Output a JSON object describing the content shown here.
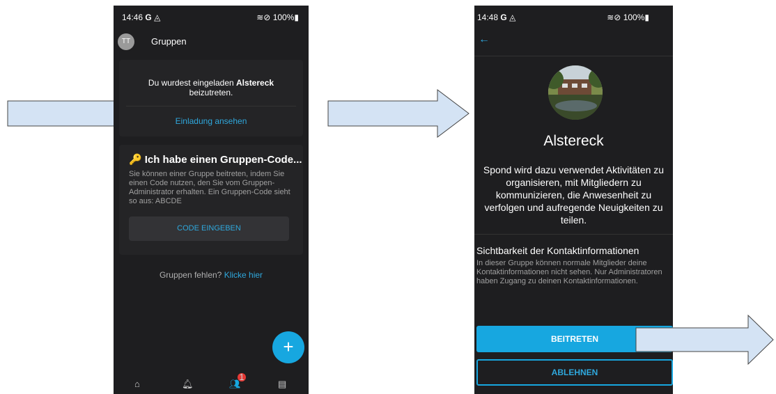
{
  "screen1": {
    "status": {
      "time": "14:46",
      "g": "G",
      "icons_right": "100%"
    },
    "header": {
      "avatar": "TT",
      "title": "Gruppen"
    },
    "invite": {
      "text_prefix": "Du wurdest eingeladen ",
      "group": "Alstereck",
      "text_suffix": " beizutreten.",
      "link": "Einladung ansehen"
    },
    "code": {
      "title": "Ich habe einen Gruppen-Code...",
      "description": "Sie können einer Gruppe beitreten, indem Sie einen Code nutzen, den Sie vom Gruppen-Administrator erhalten. Ein Gruppen-Code sieht so aus: ABCDE",
      "button": "CODE EINGEBEN"
    },
    "missing": {
      "text": "Gruppen fehlen? ",
      "link": "Klicke hier"
    },
    "fab": "+",
    "nav": {
      "badge": "1"
    }
  },
  "screen2": {
    "status": {
      "time": "14:48",
      "g": "G",
      "icons_right": "100%"
    },
    "group_name": "Alstereck",
    "description": "Spond wird dazu verwendet Aktivitäten zu organisieren, mit Mitgliedern zu kommunizieren, die Anwesenheit zu verfolgen und aufregende Neuigkeiten zu teilen.",
    "visibility_title": "Sichtbarkeit der Kontaktinformationen",
    "visibility_text": "In dieser Gruppe können normale Mitglieder deine Kontaktinformationen nicht sehen. Nur Administratoren haben Zugang zu deinen Kontaktinformationen.",
    "join_button": "BEITRETEN",
    "decline_button": "ABLEHNEN"
  },
  "colors": {
    "accent": "#17a7e0",
    "arrow_fill": "#d4e3f4",
    "phone_bg": "#1e1e20"
  }
}
